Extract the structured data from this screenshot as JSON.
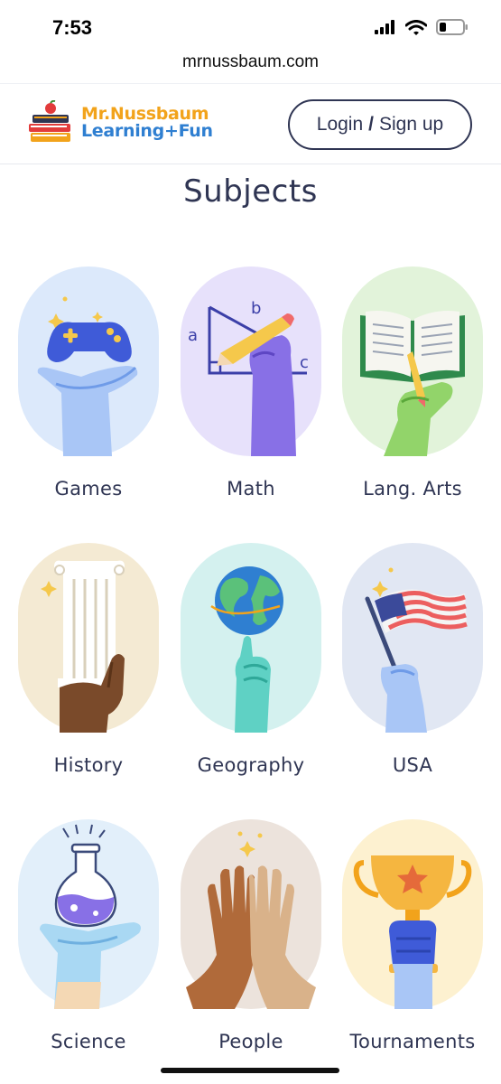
{
  "status_bar": {
    "time": "7:53"
  },
  "browser": {
    "url": "mrnussbaum.com"
  },
  "header": {
    "logo_line1": "Mr.Nussbaum",
    "logo_line2": "Learning+Fun",
    "login_label": "Login",
    "login_separator": "/",
    "signup_label": "Sign up"
  },
  "section_title": "Subjects",
  "subjects": [
    {
      "label": "Games",
      "bg": "#dce9fb",
      "icon": "game-controller-icon"
    },
    {
      "label": "Math",
      "bg": "#e7e1fb",
      "icon": "triangle-pencil-icon"
    },
    {
      "label": "Lang. Arts",
      "bg": "#e2f3da",
      "icon": "open-book-icon"
    },
    {
      "label": "History",
      "bg": "#f4ead3",
      "icon": "greek-column-icon"
    },
    {
      "label": "Geography",
      "bg": "#d4f1ef",
      "icon": "globe-icon"
    },
    {
      "label": "USA",
      "bg": "#e1e7f3",
      "icon": "american-flag-icon"
    },
    {
      "label": "Science",
      "bg": "#e2effa",
      "icon": "flask-icon"
    },
    {
      "label": "People",
      "bg": "#ece3dc",
      "icon": "high-five-icon"
    },
    {
      "label": "Tournaments",
      "bg": "#fdf1d0",
      "icon": "trophy-icon"
    }
  ]
}
